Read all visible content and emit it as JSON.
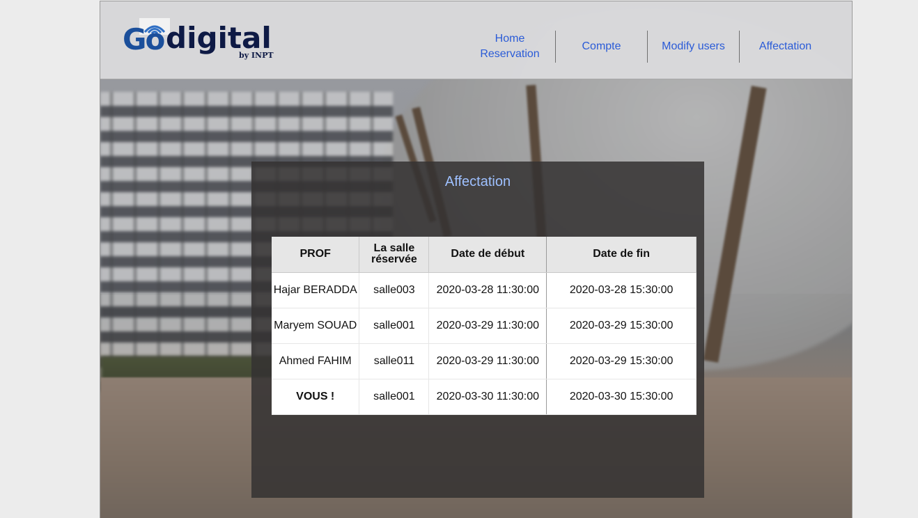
{
  "brand": {
    "logo_text_go": "Go",
    "logo_text_digital": "digital",
    "logo_subtext": "by INPT"
  },
  "nav": {
    "items": [
      {
        "label": "Home Reservation"
      },
      {
        "label": "Compte"
      },
      {
        "label": "Modify users"
      },
      {
        "label": "Affectation"
      }
    ]
  },
  "panel": {
    "title": "Affectation",
    "table": {
      "headers": [
        "PROF",
        "La salle réservée",
        "Date de début",
        "Date de fin"
      ],
      "rows": [
        [
          "Hajar BERADDA",
          "salle003",
          "2020-03-28 11:30:00",
          "2020-03-28 15:30:00"
        ],
        [
          "Maryem SOUAD",
          "salle001",
          "2020-03-29 11:30:00",
          "2020-03-29 15:30:00"
        ],
        [
          "Ahmed FAHIM",
          "salle011",
          "2020-03-29 11:30:00",
          "2020-03-29 15:30:00"
        ],
        [
          "VOUS !",
          "salle001",
          "2020-03-30 11:30:00",
          "2020-03-30 15:30:00"
        ]
      ]
    }
  },
  "colors": {
    "nav_link": "#2a5bd7",
    "panel_title": "#9ec0ff",
    "panel_bg": "#343232",
    "logo_blue": "#1b4f9b",
    "logo_dark": "#0e1a45"
  }
}
